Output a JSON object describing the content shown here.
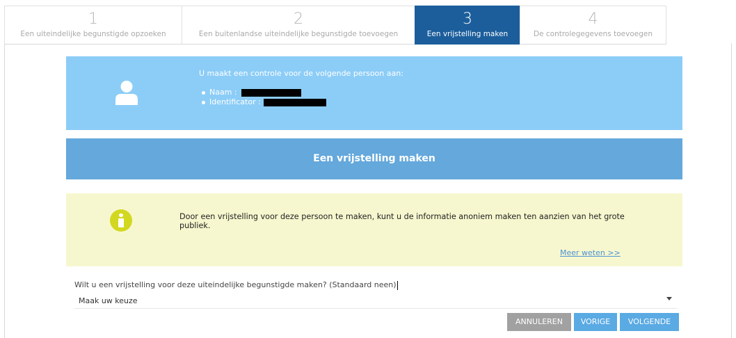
{
  "wizard": {
    "steps": [
      {
        "number": "1",
        "label": "Een uiteindelijke begunstigde opzoeken"
      },
      {
        "number": "2",
        "label": "Een buitenlandse uiteindelijke begunstigde toevoegen"
      },
      {
        "number": "3",
        "label": "Een vrijstelling maken"
      },
      {
        "number": "4",
        "label": "De controlegegevens toevoegen"
      }
    ],
    "active_step": 3
  },
  "person_panel": {
    "icon": "user-icon",
    "intro": "U maakt een controle voor de volgende persoon aan:",
    "name_label": "Naam :",
    "identifier_label": "Identificator :"
  },
  "section": {
    "title": "Een vrijstelling maken"
  },
  "info": {
    "icon": "info-icon",
    "text": "Door een vrijstelling voor deze persoon te maken, kunt u de informatie anoniem maken ten aanzien van het grote publiek.",
    "link": "Meer weten >>"
  },
  "form": {
    "question": "Wilt u een vrijstelling voor deze uiteindelijke begunstigde maken? (Standaard neen)",
    "select_value": "Maak uw keuze"
  },
  "buttons": {
    "cancel": "ANNULEREN",
    "previous": "VORIGE",
    "next": "VOLGENDE"
  },
  "colors": {
    "active_step": "#1c5e9c",
    "person_panel": "#8ccdf7",
    "section_title": "#64a8dc",
    "info_box": "#f7f7cf",
    "info_icon": "#d2d820",
    "button_primary": "#5aaae3",
    "button_cancel": "#a1a1a1"
  }
}
